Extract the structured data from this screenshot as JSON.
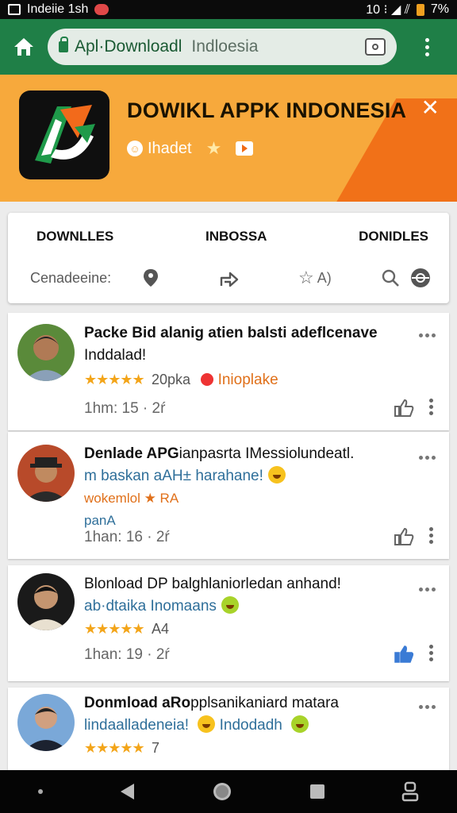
{
  "status_bar": {
    "title": "Indeiie 1sh",
    "right_text": "10 ⁝ ◢ ⫽",
    "battery": "7%"
  },
  "browser": {
    "url_main": "Apl·Downloadl",
    "url_sub": "Indloesia"
  },
  "banner": {
    "title": "DOWIKL APPK INDONESIA",
    "meta_label": "Ihadet",
    "colors": {
      "background": "#f7a93c",
      "accent": "#f06a14"
    }
  },
  "filters": {
    "tabs": [
      "DOWNLLES",
      "INBOSSA",
      "DONIDLES"
    ],
    "label": "Cenadeeine:",
    "icons": [
      "location-icon",
      "share-icon",
      "star-icon",
      "search-icon",
      "globe-icon"
    ],
    "star_text": "A)"
  },
  "reviews": [
    {
      "line1": "Packe Bid alanig atien balsti adeflcenave",
      "line2": "Inddalad!",
      "stars": "★★★★★",
      "rating": "20pka",
      "badge_text": "Inioplake",
      "timestamp": "1hm: 15 · 2ŕ",
      "liked": false
    },
    {
      "line1_bold": "Denlade APG",
      "line1_rest": "ianpasrta IMessiolundeatl.",
      "line2": "m baskan aAH± harahane!",
      "line3": "wokemlol ★ RA",
      "line4": "panA",
      "timestamp": "1han: 16 · 2ŕ",
      "liked": false
    },
    {
      "line1": "Blonload DP balghlaniorledan anhand!",
      "line2": "ab·dtaika Inomaans",
      "stars": "★★★★★",
      "rating": "A4",
      "timestamp": "1han: 19 · 2ŕ",
      "liked": true
    },
    {
      "line1_bold": "Donmload aRo",
      "line1_rest": "pplsanikaniard matara",
      "line2": "lindaalladeneia!",
      "line2_b": "Indodadh",
      "stars": "★★★★★",
      "rating": "7"
    }
  ],
  "colors": {
    "browser_bar": "#1f7f47",
    "star": "#f3a51a",
    "link_blue": "#2f6f9a",
    "like_active": "#3a7bd5"
  }
}
